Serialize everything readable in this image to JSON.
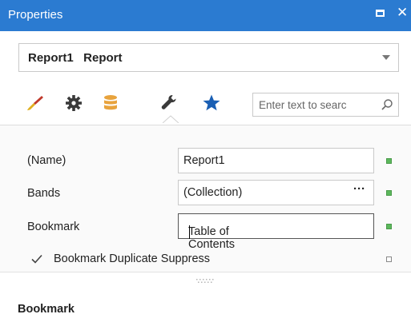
{
  "window": {
    "title": "Properties"
  },
  "object_selector": {
    "value": "Report1   Report"
  },
  "tabs": [
    {
      "name": "appearance",
      "icon": "brush-icon"
    },
    {
      "name": "behavior",
      "icon": "gear-icon"
    },
    {
      "name": "data",
      "icon": "database-icon"
    },
    {
      "name": "actions",
      "icon": "wrench-icon",
      "selected": true
    },
    {
      "name": "favorites",
      "icon": "star-icon"
    }
  ],
  "search": {
    "placeholder": "Enter text to searc"
  },
  "properties": [
    {
      "label": "(Name)",
      "value": "Report1",
      "marker": "green"
    },
    {
      "label": "Bands",
      "value": "(Collection)",
      "ellipsis": "···",
      "marker": "green"
    },
    {
      "label": "Bookmark",
      "value": "Table of Contents",
      "marker": "green",
      "focused": true
    }
  ],
  "checkbox": {
    "label": "Bookmark Duplicate Suppress",
    "checked": true
  },
  "description": {
    "title": "Bookmark"
  },
  "colors": {
    "titlebar": "#2b7bd1",
    "accent": "#1a5fb4",
    "marker_green": "#5cb85c"
  }
}
